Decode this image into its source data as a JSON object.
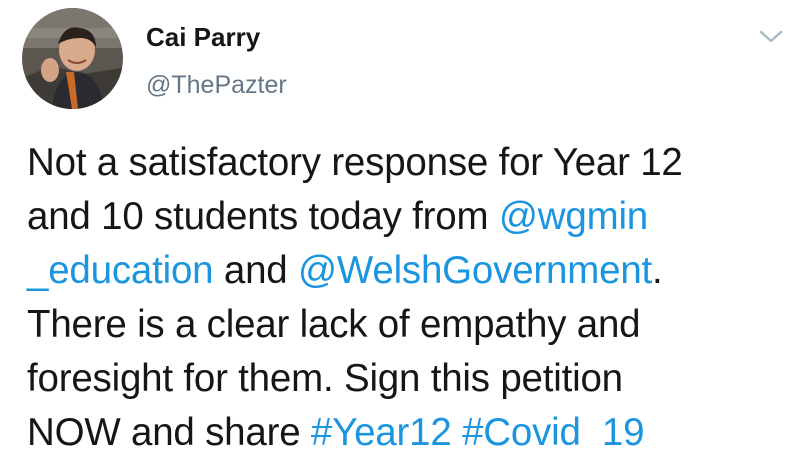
{
  "tweet": {
    "display_name": "Cai Parry",
    "handle": "@ThePazter",
    "lines": [
      [
        {
          "text": "Not a satisfactory response for Year 12",
          "link": false
        }
      ],
      [
        {
          "text": "and 10 students today from ",
          "link": false
        },
        {
          "text": "@wgmin",
          "link": true
        }
      ],
      [
        {
          "text": "_education",
          "link": true
        },
        {
          "text": " and ",
          "link": false
        },
        {
          "text": "@WelshGovernment",
          "link": true
        },
        {
          "text": ".",
          "link": false
        }
      ],
      [
        {
          "text": "There is a clear lack of empathy and",
          "link": false
        }
      ],
      [
        {
          "text": "foresight for them. Sign this petition",
          "link": false
        }
      ],
      [
        {
          "text": "NOW and share ",
          "link": false
        },
        {
          "text": "#Year12",
          "link": true
        },
        {
          "text": " ",
          "link": false
        },
        {
          "text": "#Covid_19",
          "link": true
        }
      ]
    ]
  },
  "icons": {
    "avatar": "profile-photo",
    "menu": "chevron-down-icon"
  },
  "colors": {
    "text": "#14171a",
    "secondary": "#657786",
    "link": "#1b95e0",
    "caret": "#aab8c2"
  }
}
